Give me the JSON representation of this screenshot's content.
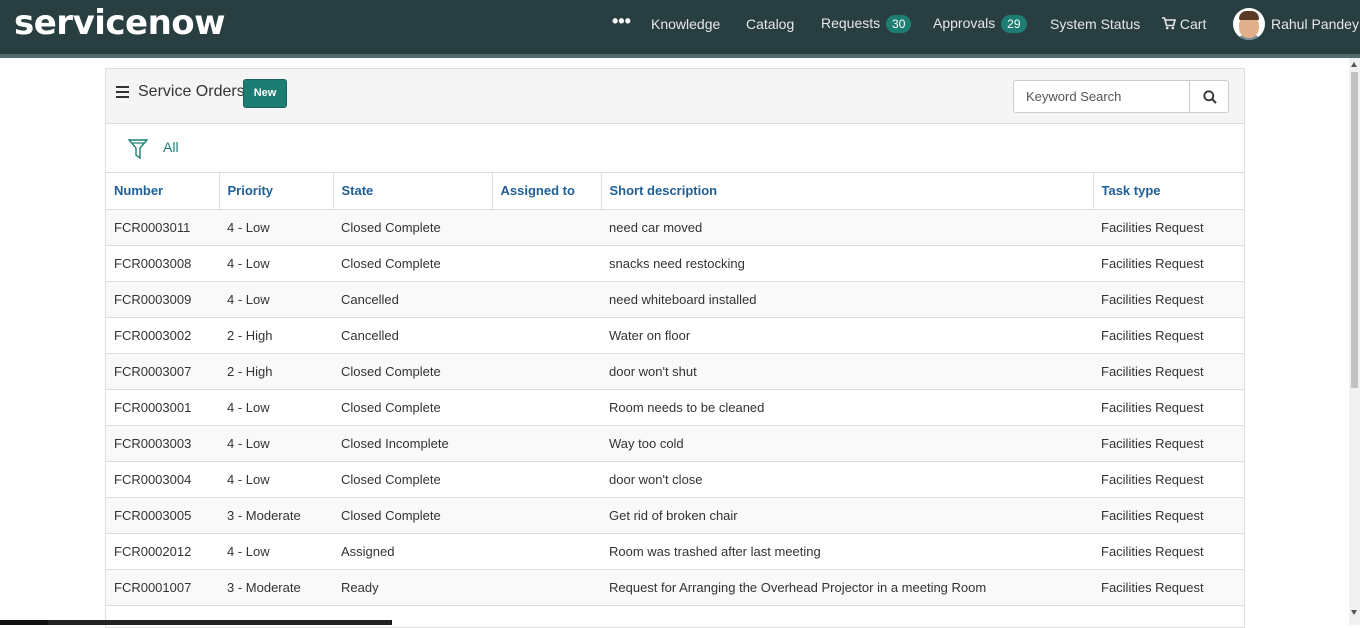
{
  "header": {
    "logo": "servicenow",
    "nav": {
      "more": "•••",
      "knowledge": "Knowledge",
      "catalog": "Catalog",
      "requests": "Requests",
      "requests_count": "30",
      "approvals": "Approvals",
      "approvals_count": "29",
      "system_status": "System Status",
      "cart": "Cart"
    },
    "user": {
      "name": "Rahul Pandey"
    }
  },
  "panel": {
    "title": "Service Orders",
    "new_label": "New",
    "search_placeholder": "Keyword Search",
    "filter_label": "All"
  },
  "table": {
    "columns": [
      "Number",
      "Priority",
      "State",
      "Assigned to",
      "Short description",
      "Task type"
    ],
    "rows": [
      [
        "FCR0003011",
        "4 - Low",
        "Closed Complete",
        "",
        "need car moved",
        "Facilities Request"
      ],
      [
        "FCR0003008",
        "4 - Low",
        "Closed Complete",
        "",
        "snacks need restocking",
        "Facilities Request"
      ],
      [
        "FCR0003009",
        "4 - Low",
        "Cancelled",
        "",
        "need whiteboard installed",
        "Facilities Request"
      ],
      [
        "FCR0003002",
        "2 - High",
        "Cancelled",
        "",
        "Water on floor",
        "Facilities Request"
      ],
      [
        "FCR0003007",
        "2 - High",
        "Closed Complete",
        "",
        "door won't shut",
        "Facilities Request"
      ],
      [
        "FCR0003001",
        "4 - Low",
        "Closed Complete",
        "",
        "Room needs to be cleaned",
        "Facilities Request"
      ],
      [
        "FCR0003003",
        "4 - Low",
        "Closed Incomplete",
        "",
        "Way too cold",
        "Facilities Request"
      ],
      [
        "FCR0003004",
        "4 - Low",
        "Closed Complete",
        "",
        "door won't close",
        "Facilities Request"
      ],
      [
        "FCR0003005",
        "3 - Moderate",
        "Closed Complete",
        "",
        "Get rid of broken chair",
        "Facilities Request"
      ],
      [
        "FCR0002012",
        "4 - Low",
        "Assigned",
        "",
        "Room was trashed after last meeting",
        "Facilities Request"
      ],
      [
        "FCR0001007",
        "3 - Moderate",
        "Ready",
        "",
        "Request for Arranging the Overhead Projector in a meeting Room",
        "Facilities Request"
      ]
    ]
  },
  "colors": {
    "topbar": "#293e40",
    "accent": "#1e7d73",
    "header_link": "#1f5f96"
  }
}
